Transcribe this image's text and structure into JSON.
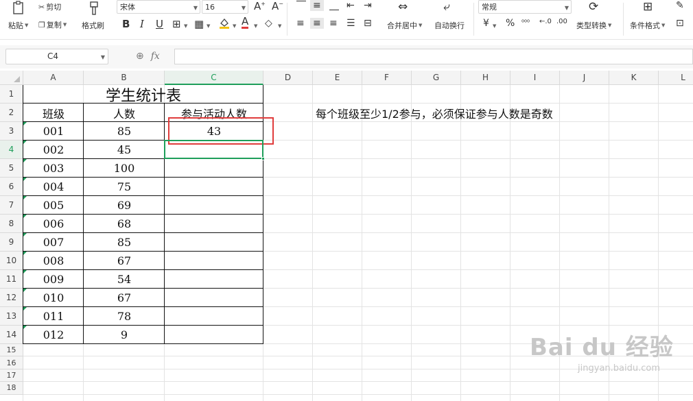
{
  "ribbon": {
    "paste_label": "粘贴",
    "cut_label": "剪切",
    "copy_label": "复制",
    "format_painter_label": "格式刷",
    "font_name": "宋体",
    "font_size": "16",
    "bold_label": "B",
    "italic_label": "I",
    "underline_label": "U",
    "font_color_label": "A",
    "merge_center_label": "合并居中",
    "wrap_text_label": "自动换行",
    "number_format": "常规",
    "currency_label": "¥",
    "percent_label": "%",
    "type_convert_label": "类型转换",
    "cond_format_label": "条件格式"
  },
  "formula_bar": {
    "cell_ref": "C4",
    "fx_label": "fx",
    "formula": ""
  },
  "columns": [
    "A",
    "B",
    "C",
    "D",
    "E",
    "F",
    "G",
    "H",
    "I",
    "J",
    "K",
    "L"
  ],
  "rows": [
    "1",
    "2",
    "3",
    "4",
    "5",
    "6",
    "7",
    "8",
    "9",
    "10",
    "11",
    "12",
    "13",
    "14",
    "15",
    "16",
    "17",
    "18"
  ],
  "sheet": {
    "title": "学生统计表",
    "headers": [
      "班级",
      "人数",
      "参与活动人数"
    ],
    "note": "每个班级至少1/2参与，必须保证参与人数是奇数",
    "data": [
      [
        "001",
        "85",
        "43"
      ],
      [
        "002",
        "45",
        ""
      ],
      [
        "003",
        "100",
        ""
      ],
      [
        "004",
        "75",
        ""
      ],
      [
        "005",
        "69",
        ""
      ],
      [
        "006",
        "68",
        ""
      ],
      [
        "007",
        "85",
        ""
      ],
      [
        "008",
        "67",
        ""
      ],
      [
        "009",
        "54",
        ""
      ],
      [
        "010",
        "67",
        ""
      ],
      [
        "011",
        "78",
        ""
      ],
      [
        "012",
        "9",
        ""
      ]
    ]
  },
  "watermark": {
    "brand": "Bai du 经验",
    "url": "jingyan.baidu.com"
  },
  "colors": {
    "active_green": "#1e9e5a",
    "highlight_red": "#e03c3c"
  }
}
